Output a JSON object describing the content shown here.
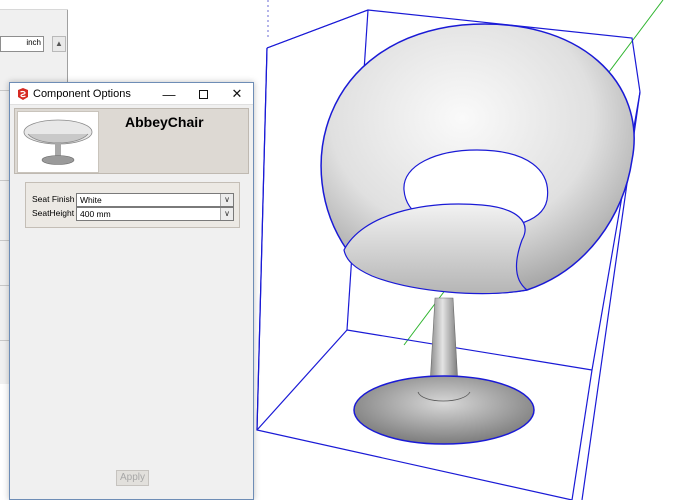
{
  "background_panel": {
    "unit_label": "inch"
  },
  "dialog": {
    "title": "Component Options",
    "component_name": "AbbeyChair",
    "options": [
      {
        "label": "Seat Finish",
        "value": "White"
      },
      {
        "label": "SeatHeight",
        "value": "400 mm"
      }
    ],
    "apply_label": "Apply",
    "window_controls": {
      "minimize_icon": "minimize-icon",
      "maximize_icon": "maximize-icon",
      "close_icon": "close-icon"
    }
  },
  "colors": {
    "bounding_box": "#1a1ad6",
    "green_axis": "#2fb52f",
    "app_icon_red": "#d62a22"
  }
}
